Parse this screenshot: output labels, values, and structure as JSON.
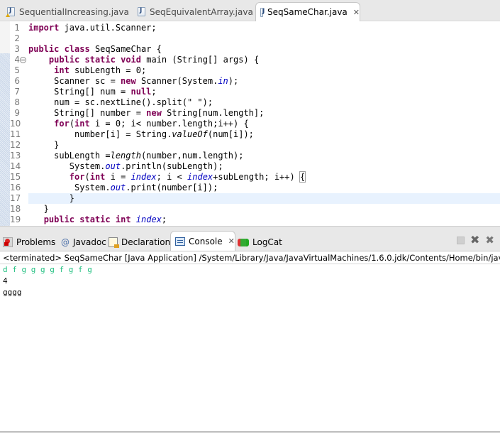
{
  "editor_tabs": [
    {
      "label": "SequentialIncreasing.java",
      "icon": "java-file-warning-icon",
      "active": false
    },
    {
      "label": "SeqEquivalentArray.java",
      "icon": "java-file-icon",
      "active": false
    },
    {
      "label": "SeqSameChar.java",
      "icon": "java-file-icon",
      "active": true,
      "close": "✕"
    }
  ],
  "code": {
    "line_numbers": [
      "1",
      "2",
      "3",
      "4",
      "5",
      "6",
      "7",
      "8",
      "9",
      "10",
      "11",
      "12",
      "13",
      "14",
      "15",
      "16",
      "17",
      "18",
      "19"
    ],
    "lines": [
      {
        "segments": [
          {
            "t": "import",
            "c": "kw"
          },
          {
            "t": " java.util.Scanner;"
          }
        ]
      },
      {
        "segments": []
      },
      {
        "segments": [
          {
            "t": "public",
            "c": "kw"
          },
          {
            "t": " "
          },
          {
            "t": "class",
            "c": "kw"
          },
          {
            "t": " SeqSameChar {"
          }
        ]
      },
      {
        "segments": [
          {
            "t": "    "
          },
          {
            "t": "public",
            "c": "kw"
          },
          {
            "t": " "
          },
          {
            "t": "static",
            "c": "kw"
          },
          {
            "t": " "
          },
          {
            "t": "void",
            "c": "kw"
          },
          {
            "t": " main (String[] args) {"
          }
        ]
      },
      {
        "segments": [
          {
            "t": "     "
          },
          {
            "t": "int",
            "c": "kw"
          },
          {
            "t": " subLength = 0;"
          }
        ]
      },
      {
        "segments": [
          {
            "t": "     Scanner sc = "
          },
          {
            "t": "new",
            "c": "kw"
          },
          {
            "t": " Scanner(System."
          },
          {
            "t": "in",
            "c": "fld"
          },
          {
            "t": ");"
          }
        ]
      },
      {
        "segments": [
          {
            "t": "     String[] num = "
          },
          {
            "t": "null",
            "c": "kw"
          },
          {
            "t": ";"
          }
        ]
      },
      {
        "segments": [
          {
            "t": "     num = sc.nextLine().split(\" \");"
          }
        ]
      },
      {
        "segments": [
          {
            "t": "     String[] number = "
          },
          {
            "t": "new",
            "c": "kw"
          },
          {
            "t": " String[num.length];"
          }
        ]
      },
      {
        "segments": [
          {
            "t": "     "
          },
          {
            "t": "for",
            "c": "kw"
          },
          {
            "t": "("
          },
          {
            "t": "int",
            "c": "kw"
          },
          {
            "t": " i = 0; i< number.length;i++) {"
          }
        ]
      },
      {
        "segments": [
          {
            "t": "         number[i] = String."
          },
          {
            "t": "valueOf",
            "c": "mi"
          },
          {
            "t": "(num[i]);"
          }
        ]
      },
      {
        "segments": [
          {
            "t": "     }"
          }
        ]
      },
      {
        "segments": [
          {
            "t": "     subLength ="
          },
          {
            "t": "length",
            "c": "mi"
          },
          {
            "t": "(number,num.length);"
          }
        ]
      },
      {
        "segments": [
          {
            "t": "        System."
          },
          {
            "t": "out",
            "c": "fld"
          },
          {
            "t": ".println(subLength);"
          }
        ]
      },
      {
        "segments": [
          {
            "t": "        "
          },
          {
            "t": "for",
            "c": "kw"
          },
          {
            "t": "("
          },
          {
            "t": "int",
            "c": "kw"
          },
          {
            "t": " i = "
          },
          {
            "t": "index",
            "c": "fld"
          },
          {
            "t": "; i < "
          },
          {
            "t": "index",
            "c": "fld"
          },
          {
            "t": "+subLength; i++) "
          },
          {
            "t": "{",
            "c": "brk"
          }
        ]
      },
      {
        "segments": [
          {
            "t": "         System."
          },
          {
            "t": "out",
            "c": "fld"
          },
          {
            "t": ".print(number[i]);"
          }
        ]
      },
      {
        "segments": [
          {
            "t": "        }"
          }
        ]
      },
      {
        "segments": [
          {
            "t": "   }"
          }
        ]
      },
      {
        "segments": [
          {
            "t": "   "
          },
          {
            "t": "public",
            "c": "kw"
          },
          {
            "t": " "
          },
          {
            "t": "static",
            "c": "kw"
          },
          {
            "t": " "
          },
          {
            "t": "int",
            "c": "kw"
          },
          {
            "t": " "
          },
          {
            "t": "index",
            "c": "fld"
          },
          {
            "t": ";"
          }
        ]
      }
    ],
    "current_line": 17
  },
  "views": {
    "tabs": [
      {
        "label": "Problems",
        "icon": "problems-icon"
      },
      {
        "label": "Javadoc",
        "icon": "javadoc-at-icon",
        "glyph": "@"
      },
      {
        "label": "Declaration",
        "icon": "declaration-icon"
      },
      {
        "label": "Console",
        "icon": "console-icon",
        "active": true,
        "close": "✕"
      },
      {
        "label": "LogCat",
        "icon": "logcat-icon"
      }
    ],
    "tools": {
      "remove": "✖",
      "remove_all": "✖✖"
    }
  },
  "console": {
    "header": "<terminated> SeqSameChar [Java Application] /System/Library/Java/JavaVirtualMachines/1.6.0.jdk/Contents/Home/bin/java (Sep",
    "input_line": "d f g g g g f g f g",
    "output_lines": [
      "4",
      "gggg"
    ],
    "colors": {
      "input": "#1fbf7f"
    }
  }
}
